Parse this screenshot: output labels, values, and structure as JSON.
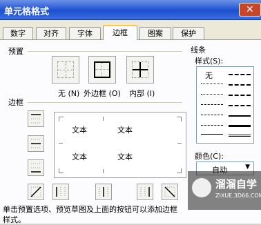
{
  "window": {
    "title": "单元格格式"
  },
  "tabs": [
    "数字",
    "对齐",
    "字体",
    "边框",
    "图案",
    "保护"
  ],
  "active_tab": "边框",
  "presets": {
    "label": "预置",
    "items": [
      {
        "label": "无 (N)"
      },
      {
        "label": "外边框 (O)"
      },
      {
        "label": "内部 (I)"
      }
    ]
  },
  "border": {
    "label": "边框",
    "preview_text": [
      "文本",
      "文本",
      "文本",
      "文本"
    ]
  },
  "line": {
    "group_label": "线条",
    "style_label": "样式(S):",
    "none_label": "无",
    "color_label": "颜色(C):",
    "color_value": "自动"
  },
  "hint": "单击预置选项、预览草图及上面的按钮可以添加边框样式。",
  "watermark": {
    "text": "溜溜自学",
    "sub": "ZIXUE.3D66.COM"
  },
  "colors": {
    "accent": "#2a5bd7",
    "close": "#c8452a",
    "tab_highlight": "#ffc83c"
  }
}
